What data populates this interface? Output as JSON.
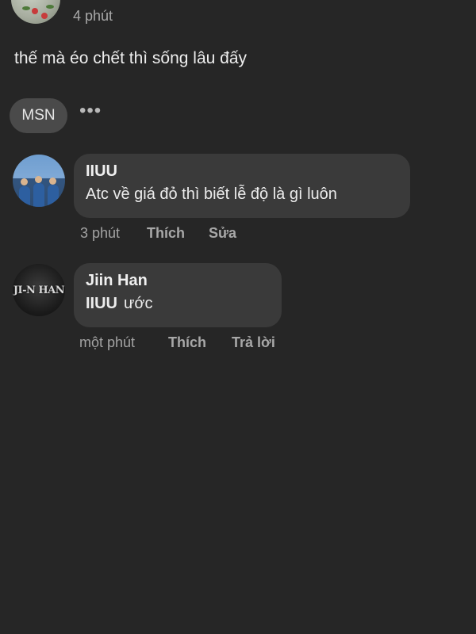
{
  "post": {
    "time": "4 phút",
    "text": "thế mà éo chết thì sống lâu đấy"
  },
  "reactions": {
    "chip_label": "MSN",
    "more_label": "•••"
  },
  "comments": [
    {
      "author": "IIUU",
      "text": "Atc về giá đỏ thì biết lễ độ là gì luôn",
      "time": "3 phút",
      "actions": [
        "Thích",
        "Sửa"
      ]
    },
    {
      "author": "Jiin Han",
      "mention": "IIUU",
      "text": "ước",
      "avatar_logo": "JI-N HAN",
      "time": "một phút",
      "actions": [
        "Thích",
        "Trả lời"
      ]
    }
  ],
  "colors": {
    "background": "#262626",
    "bubble": "#3a3a3a",
    "meta_text": "#a3a3a3"
  }
}
